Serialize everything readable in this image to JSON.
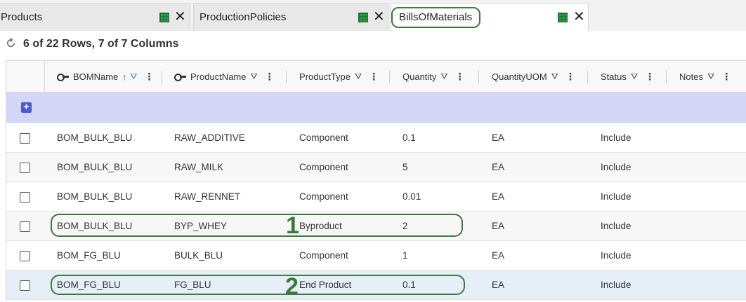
{
  "tabs": [
    {
      "label": "Products",
      "close": "✕"
    },
    {
      "label": "ProductionPolicies",
      "close": "✕"
    },
    {
      "label": "BillsOfMaterials",
      "close": "✕",
      "active": true
    }
  ],
  "info": {
    "row_count_text": "6 of 22 Rows, 7 of 7 Columns"
  },
  "columns": [
    {
      "label": "BOMName",
      "key": true,
      "sort": "↑"
    },
    {
      "label": "ProductName",
      "key": true
    },
    {
      "label": "ProductType"
    },
    {
      "label": "Quantity"
    },
    {
      "label": "QuantityUOM"
    },
    {
      "label": "Status"
    },
    {
      "label": "Notes"
    }
  ],
  "header_icons": {
    "filter": "⛛",
    "menu": "⋮",
    "add": "+"
  },
  "rows": [
    [
      "BOM_BULK_BLU",
      "RAW_ADDITIVE",
      "Component",
      "0.1",
      "EA",
      "Include",
      ""
    ],
    [
      "BOM_BULK_BLU",
      "RAW_MILK",
      "Component",
      "5",
      "EA",
      "Include",
      ""
    ],
    [
      "BOM_BULK_BLU",
      "RAW_RENNET",
      "Component",
      "0.01",
      "EA",
      "Include",
      ""
    ],
    [
      "BOM_BULK_BLU",
      "BYP_WHEY",
      "Byproduct",
      "2",
      "EA",
      "Include",
      ""
    ],
    [
      "BOM_FG_BLU",
      "BULK_BLU",
      "Component",
      "1",
      "EA",
      "Include",
      ""
    ],
    [
      "BOM_FG_BLU",
      "FG_BLU",
      "End Product",
      "0.1",
      "EA",
      "Include",
      ""
    ]
  ],
  "annotations": [
    {
      "number": "1"
    },
    {
      "number": "2"
    }
  ],
  "colors": {
    "accent_ring": "#3b7a3f",
    "add_row": "#d4d6f7",
    "add_button": "#4b57d8",
    "selected_row": "#e6eef7"
  }
}
